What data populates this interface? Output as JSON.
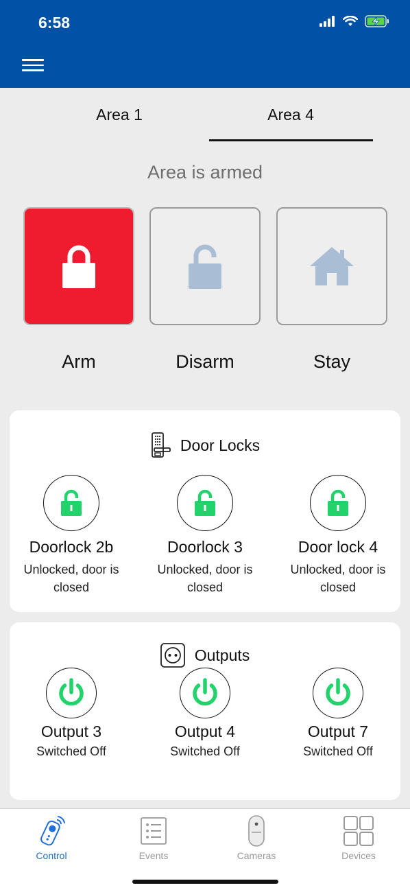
{
  "status_bar": {
    "time": "6:58"
  },
  "tabs": [
    {
      "label": "Area 1",
      "active": false
    },
    {
      "label": "Area 4",
      "active": true
    }
  ],
  "area_status": "Area is armed",
  "modes": [
    {
      "label": "Arm",
      "icon": "lock-icon",
      "active": true
    },
    {
      "label": "Disarm",
      "icon": "unlock-icon",
      "active": false
    },
    {
      "label": "Stay",
      "icon": "home-icon",
      "active": false
    }
  ],
  "door_locks": {
    "title": "Door Locks",
    "items": [
      {
        "name": "Doorlock 2b",
        "state": "Unlocked, door is closed"
      },
      {
        "name": "Doorlock 3",
        "state": "Unlocked, door is closed"
      },
      {
        "name": "Door lock 4",
        "state": "Unlocked, door is closed"
      }
    ]
  },
  "outputs": {
    "title": "Outputs",
    "items": [
      {
        "name": "Output 3",
        "state": "Switched Off"
      },
      {
        "name": "Output 4",
        "state": "Switched Off"
      },
      {
        "name": "Output 7",
        "state": "Switched Off"
      }
    ]
  },
  "bottom_nav": [
    {
      "label": "Control",
      "active": true
    },
    {
      "label": "Events",
      "active": false
    },
    {
      "label": "Cameras",
      "active": false
    },
    {
      "label": "Devices",
      "active": false
    }
  ],
  "colors": {
    "header": "#0152a6",
    "arm_active": "#ee1c2e",
    "inactive_icon": "#a9bdd4",
    "status_green": "#22d36b",
    "nav_active": "#1e6fd9"
  }
}
